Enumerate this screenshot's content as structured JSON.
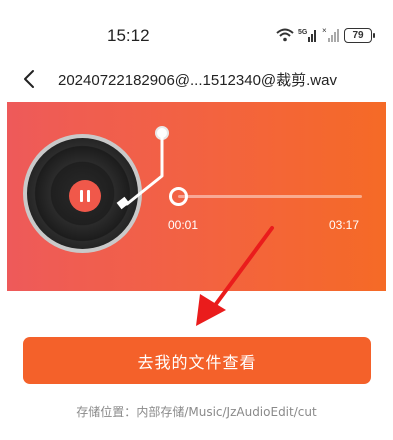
{
  "status_bar": {
    "time": "15:12",
    "network_label": "5G",
    "battery": "79",
    "icons": [
      "wifi-icon",
      "signal-icon",
      "signal-muted-icon",
      "battery-icon"
    ]
  },
  "header": {
    "back_icon": "chevron-left-icon",
    "title": "20240722182906@...1512340@裁剪.wav"
  },
  "player": {
    "state": "playing",
    "current_time": "00:01",
    "total_time": "03:17",
    "progress": 0.005,
    "gradient_colors": [
      "#ee5a5a",
      "#f56a26"
    ]
  },
  "actions": {
    "open_files_label": "去我的文件查看",
    "accent_color": "#f4612a"
  },
  "footer": {
    "storage_label": "存储位置：",
    "storage_path": "内部存储/Music/JzAudioEdit/cut"
  }
}
